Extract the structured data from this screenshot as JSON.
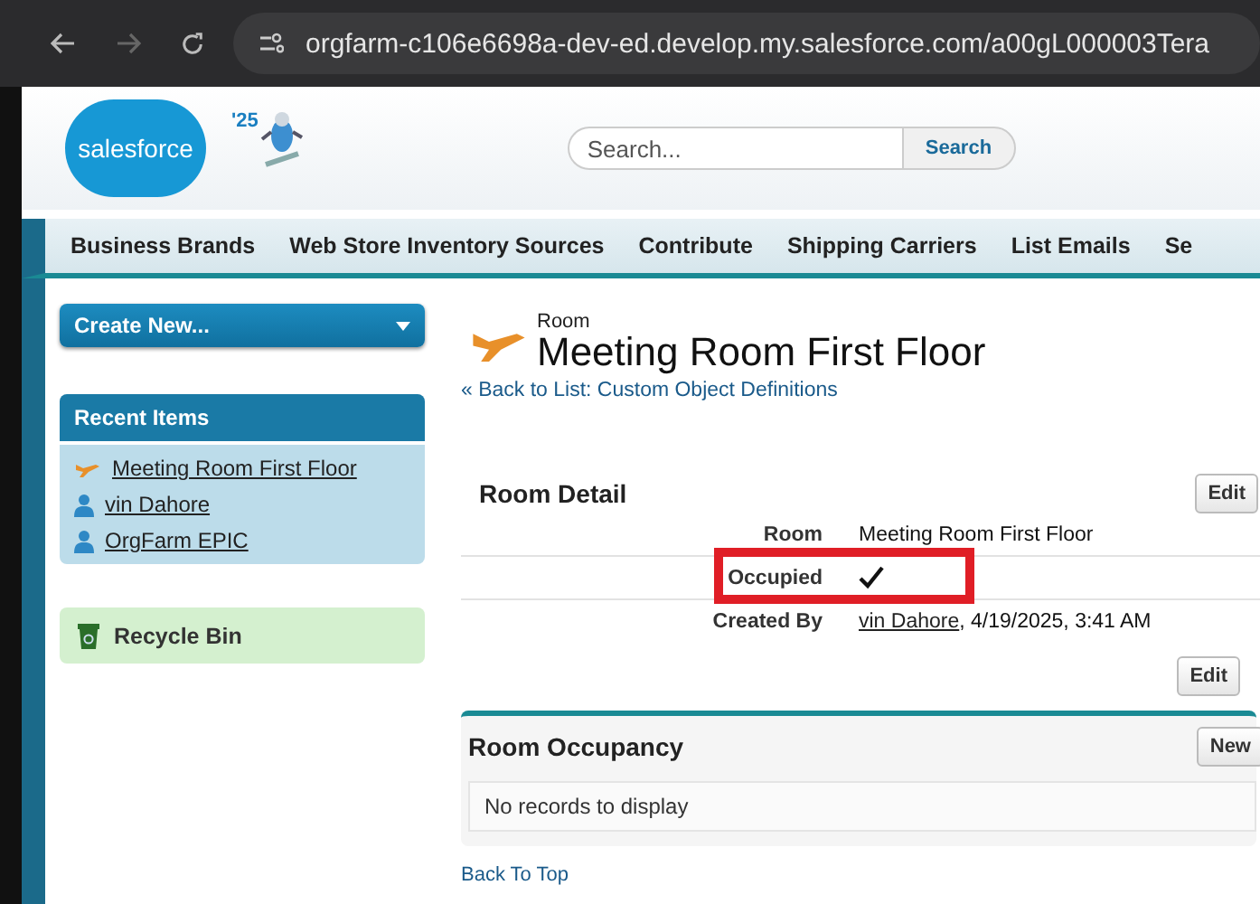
{
  "browser": {
    "url": "orgfarm-c106e6698a-dev-ed.develop.my.salesforce.com/a00gL000003Tera"
  },
  "header": {
    "logo": "salesforce",
    "release_badge": "'25",
    "search": {
      "placeholder": "Search...",
      "button": "Search"
    }
  },
  "tabs": [
    {
      "label": "Business Brands"
    },
    {
      "label": "Web Store Inventory Sources"
    },
    {
      "label": "Contribute"
    },
    {
      "label": "Shipping Carriers"
    },
    {
      "label": "List Emails"
    },
    {
      "label": "Se"
    }
  ],
  "sidebar": {
    "create_new": "Create New...",
    "recent_title": "Recent Items",
    "recent_items": [
      {
        "label": "Meeting Room First Floor",
        "kind": "room"
      },
      {
        "label": "vin Dahore",
        "kind": "user"
      },
      {
        "label": "OrgFarm EPIC",
        "kind": "user"
      }
    ],
    "recycle_bin": "Recycle Bin"
  },
  "record": {
    "object": "Room",
    "title": "Meeting Room First Floor",
    "back_link": "« Back to List: Custom Object Definitions"
  },
  "detail": {
    "title": "Room Detail",
    "edit": "Edit",
    "fields": [
      {
        "label": "Room",
        "value": "Meeting Room First Floor",
        "kind": "text"
      },
      {
        "label": "Occupied",
        "checked": true,
        "kind": "checkbox",
        "highlighted": true
      },
      {
        "label": "Created By",
        "link": "vin Dahore",
        "value": ", 4/19/2025, 3:41 AM",
        "kind": "link"
      }
    ],
    "edit_bottom": "Edit"
  },
  "related": {
    "title": "Room Occupancy",
    "button": "New",
    "empty": "No records to display"
  },
  "footer": {
    "back_to_top": "Back To Top"
  }
}
